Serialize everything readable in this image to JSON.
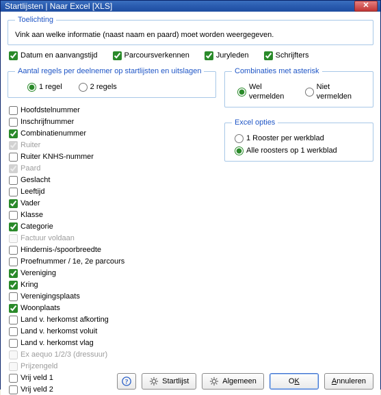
{
  "title": "Startlijsten | Naar Excel [XLS]",
  "toelichting": {
    "legend": "Toelichting",
    "text": "Vink aan welke informatie (naast naam en paard) moet worden weergegeven."
  },
  "topchecks": {
    "datum": "Datum en aanvangstijd",
    "parcours": "Parcoursverkennen",
    "jury": "Juryleden",
    "schrijfters": "Schrijfters"
  },
  "regels": {
    "legend": "Aantal regels per deelnemer op startlijsten en uitslagen",
    "opt1": "1 regel",
    "opt2": "2 regels"
  },
  "asterisk": {
    "legend": "Combinaties met asterisk",
    "opt1": "Wel vermelden",
    "opt2": "Niet vermelden"
  },
  "excel": {
    "legend": "Excel opties",
    "opt1": "1 Rooster per werkblad",
    "opt2": "Alle roosters op 1 werkblad"
  },
  "fields": [
    {
      "label": "Hoofdstelnummer",
      "checked": false,
      "disabled": false
    },
    {
      "label": "Inschrijfnummer",
      "checked": false,
      "disabled": false
    },
    {
      "label": "Combinatienummer",
      "checked": true,
      "disabled": false
    },
    {
      "label": "Ruiter",
      "checked": true,
      "disabled": true
    },
    {
      "label": "Ruiter KNHS-nummer",
      "checked": false,
      "disabled": false
    },
    {
      "label": "Paard",
      "checked": true,
      "disabled": true
    },
    {
      "label": "Geslacht",
      "checked": false,
      "disabled": false
    },
    {
      "label": "Leeftijd",
      "checked": false,
      "disabled": false
    },
    {
      "label": "Vader",
      "checked": true,
      "disabled": false
    },
    {
      "label": "Klasse",
      "checked": false,
      "disabled": false
    },
    {
      "label": "Categorie",
      "checked": true,
      "disabled": false
    },
    {
      "label": "Factuur voldaan",
      "checked": false,
      "disabled": true
    },
    {
      "label": "Hindernis-/spoorbreedte",
      "checked": false,
      "disabled": false
    },
    {
      "label": "Proefnummer / 1e, 2e parcours",
      "checked": false,
      "disabled": false
    },
    {
      "label": "Vereniging",
      "checked": true,
      "disabled": false
    },
    {
      "label": "Kring",
      "checked": true,
      "disabled": false
    },
    {
      "label": "Verenigingsplaats",
      "checked": false,
      "disabled": false
    },
    {
      "label": "Woonplaats",
      "checked": true,
      "disabled": false
    },
    {
      "label": "Land v. herkomst afkorting",
      "checked": false,
      "disabled": false
    },
    {
      "label": "Land v. herkomst voluit",
      "checked": false,
      "disabled": false
    },
    {
      "label": "Land v. herkomst vlag",
      "checked": false,
      "disabled": false
    },
    {
      "label": "Ex aequo 1/2/3 (dressuur)",
      "checked": false,
      "disabled": true
    },
    {
      "label": "Prijzengeld",
      "checked": false,
      "disabled": true
    },
    {
      "label": "Vrij veld 1",
      "checked": false,
      "disabled": false
    },
    {
      "label": "Vrij veld 2",
      "checked": false,
      "disabled": false
    }
  ],
  "buttons": {
    "startlijst": "Startlijst",
    "algemeen": "Algemeen",
    "ok_pre": "O",
    "ok_u": "K",
    "ann_pre": "",
    "ann_u": "A",
    "ann_post": "nnuleren"
  }
}
